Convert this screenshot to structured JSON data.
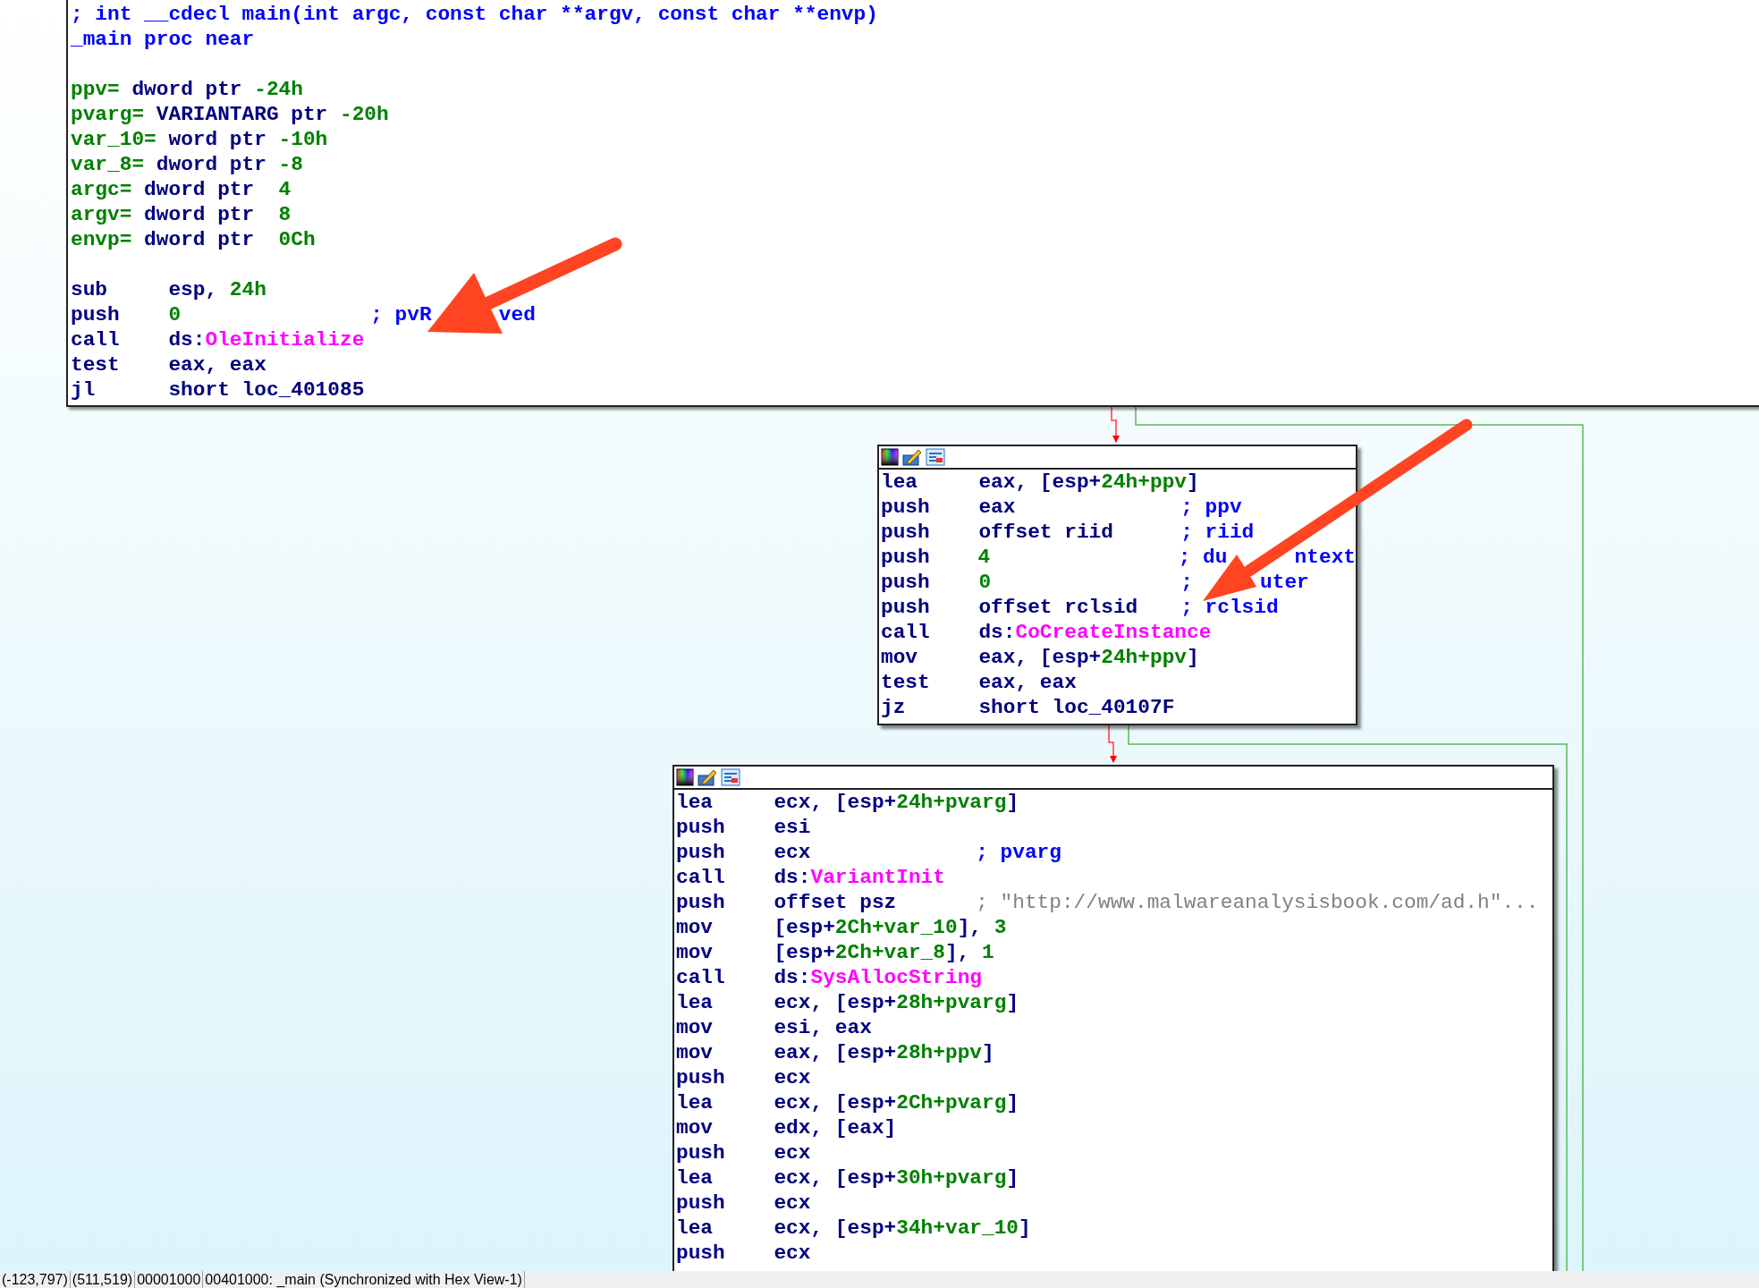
{
  "blocks": [
    {
      "header": [
        [
          {
            "kind": "comment",
            "text": "; int __cdecl main(int argc, const char **argv, const char **envp)"
          }
        ],
        [
          {
            "kind": "comment",
            "text": "_main proc near"
          }
        ]
      ],
      "locals": [
        [
          {
            "kind": "num",
            "text": "ppv="
          },
          {
            "kind": "code",
            "text": " dword ptr "
          },
          {
            "kind": "num",
            "text": "-24h"
          }
        ],
        [
          {
            "kind": "num",
            "text": "pvarg="
          },
          {
            "kind": "code",
            "text": " VARIANTARG ptr "
          },
          {
            "kind": "num",
            "text": "-20h"
          }
        ],
        [
          {
            "kind": "num",
            "text": "var_10="
          },
          {
            "kind": "code",
            "text": " word ptr "
          },
          {
            "kind": "num",
            "text": "-10h"
          }
        ],
        [
          {
            "kind": "num",
            "text": "var_8="
          },
          {
            "kind": "code",
            "text": " dword ptr "
          },
          {
            "kind": "num",
            "text": "-8"
          }
        ],
        [
          {
            "kind": "num",
            "text": "argc="
          },
          {
            "kind": "code",
            "text": " dword ptr  "
          },
          {
            "kind": "num",
            "text": "4"
          }
        ],
        [
          {
            "kind": "num",
            "text": "argv="
          },
          {
            "kind": "code",
            "text": " dword ptr  "
          },
          {
            "kind": "num",
            "text": "8"
          }
        ],
        [
          {
            "kind": "num",
            "text": "envp="
          },
          {
            "kind": "code",
            "text": " dword ptr  "
          },
          {
            "kind": "num",
            "text": "0Ch"
          }
        ]
      ],
      "code": [
        {
          "op": "sub",
          "args": [
            {
              "kind": "code",
              "text": "esp, "
            },
            {
              "kind": "num",
              "text": "24h"
            }
          ]
        },
        {
          "op": "push",
          "args": [
            {
              "kind": "num",
              "text": "0"
            }
          ],
          "comment": {
            "kind": "comment",
            "parts": [
              "; pvR",
              "ved"
            ]
          }
        },
        {
          "op": "call",
          "args": [
            {
              "kind": "code",
              "text": "ds:"
            },
            {
              "kind": "func",
              "text": "OleInitialize"
            }
          ]
        },
        {
          "op": "test",
          "args": [
            {
              "kind": "code",
              "text": "eax, eax"
            }
          ]
        },
        {
          "op": "jl",
          "args": [
            {
              "kind": "code",
              "text": "short loc_401085"
            }
          ]
        }
      ]
    },
    {
      "code": [
        {
          "op": "lea",
          "args": [
            {
              "kind": "code",
              "text": "eax, [esp+"
            },
            {
              "kind": "num",
              "text": "24h+ppv"
            },
            {
              "kind": "code",
              "text": "]"
            }
          ]
        },
        {
          "op": "push",
          "args": [
            {
              "kind": "code",
              "text": "eax"
            }
          ],
          "comment": {
            "kind": "comment",
            "parts": [
              "; ppv"
            ]
          }
        },
        {
          "op": "push",
          "args": [
            {
              "kind": "code",
              "text": "offset riid"
            }
          ],
          "comment": {
            "kind": "comment",
            "parts": [
              "; riid"
            ]
          }
        },
        {
          "op": "push",
          "args": [
            {
              "kind": "num",
              "text": "4"
            }
          ],
          "comment": {
            "kind": "comment",
            "parts": [
              "; du",
              "ntext"
            ]
          }
        },
        {
          "op": "push",
          "args": [
            {
              "kind": "num",
              "text": "0"
            }
          ],
          "comment": {
            "kind": "comment",
            "parts": [
              ";",
              "uter"
            ]
          }
        },
        {
          "op": "push",
          "args": [
            {
              "kind": "code",
              "text": "offset rclsid"
            }
          ],
          "comment": {
            "kind": "comment",
            "parts": [
              "; rclsid"
            ]
          }
        },
        {
          "op": "call",
          "args": [
            {
              "kind": "code",
              "text": "ds:"
            },
            {
              "kind": "func",
              "text": "CoCreateInstance"
            }
          ]
        },
        {
          "op": "mov",
          "args": [
            {
              "kind": "code",
              "text": "eax, [esp+"
            },
            {
              "kind": "num",
              "text": "24h+ppv"
            },
            {
              "kind": "code",
              "text": "]"
            }
          ]
        },
        {
          "op": "test",
          "args": [
            {
              "kind": "code",
              "text": "eax, eax"
            }
          ]
        },
        {
          "op": "jz",
          "args": [
            {
              "kind": "code",
              "text": "short loc_40107F"
            }
          ]
        }
      ]
    },
    {
      "code": [
        {
          "op": "lea",
          "args": [
            {
              "kind": "code",
              "text": "ecx, [esp+"
            },
            {
              "kind": "num",
              "text": "24h+pvarg"
            },
            {
              "kind": "code",
              "text": "]"
            }
          ]
        },
        {
          "op": "push",
          "args": [
            {
              "kind": "code",
              "text": "esi"
            }
          ]
        },
        {
          "op": "push",
          "args": [
            {
              "kind": "code",
              "text": "ecx"
            }
          ],
          "comment": {
            "kind": "comment",
            "parts": [
              "; pvarg"
            ]
          }
        },
        {
          "op": "call",
          "args": [
            {
              "kind": "code",
              "text": "ds:"
            },
            {
              "kind": "func",
              "text": "VariantInit"
            }
          ]
        },
        {
          "op": "push",
          "args": [
            {
              "kind": "code",
              "text": "offset psz"
            }
          ],
          "comment": {
            "kind": "string",
            "parts": [
              "; \"http://www.malwareanalysisbook.com/ad.h\"..."
            ]
          }
        },
        {
          "op": "mov",
          "args": [
            {
              "kind": "code",
              "text": "[esp+"
            },
            {
              "kind": "num",
              "text": "2Ch+var_10"
            },
            {
              "kind": "code",
              "text": "], "
            },
            {
              "kind": "num",
              "text": "3"
            }
          ]
        },
        {
          "op": "mov",
          "args": [
            {
              "kind": "code",
              "text": "[esp+"
            },
            {
              "kind": "num",
              "text": "2Ch+var_8"
            },
            {
              "kind": "code",
              "text": "], "
            },
            {
              "kind": "num",
              "text": "1"
            }
          ]
        },
        {
          "op": "call",
          "args": [
            {
              "kind": "code",
              "text": "ds:"
            },
            {
              "kind": "func",
              "text": "SysAllocString"
            }
          ]
        },
        {
          "op": "lea",
          "args": [
            {
              "kind": "code",
              "text": "ecx, [esp+"
            },
            {
              "kind": "num",
              "text": "28h+pvarg"
            },
            {
              "kind": "code",
              "text": "]"
            }
          ]
        },
        {
          "op": "mov",
          "args": [
            {
              "kind": "code",
              "text": "esi, eax"
            }
          ]
        },
        {
          "op": "mov",
          "args": [
            {
              "kind": "code",
              "text": "eax, [esp+"
            },
            {
              "kind": "num",
              "text": "28h+ppv"
            },
            {
              "kind": "code",
              "text": "]"
            }
          ]
        },
        {
          "op": "push",
          "args": [
            {
              "kind": "code",
              "text": "ecx"
            }
          ]
        },
        {
          "op": "lea",
          "args": [
            {
              "kind": "code",
              "text": "ecx, [esp+"
            },
            {
              "kind": "num",
              "text": "2Ch+pvarg"
            },
            {
              "kind": "code",
              "text": "]"
            }
          ]
        },
        {
          "op": "mov",
          "args": [
            {
              "kind": "code",
              "text": "edx, [eax]"
            }
          ]
        },
        {
          "op": "push",
          "args": [
            {
              "kind": "code",
              "text": "ecx"
            }
          ]
        },
        {
          "op": "lea",
          "args": [
            {
              "kind": "code",
              "text": "ecx, [esp+"
            },
            {
              "kind": "num",
              "text": "30h+pvarg"
            },
            {
              "kind": "code",
              "text": "]"
            }
          ]
        },
        {
          "op": "push",
          "args": [
            {
              "kind": "code",
              "text": "ecx"
            }
          ]
        },
        {
          "op": "lea",
          "args": [
            {
              "kind": "code",
              "text": "ecx, [esp+"
            },
            {
              "kind": "num",
              "text": "34h+var_10"
            },
            {
              "kind": "code",
              "text": "]"
            }
          ]
        },
        {
          "op": "push",
          "args": [
            {
              "kind": "code",
              "text": "ecx"
            }
          ]
        }
      ]
    }
  ],
  "status_bar": [
    "(-123,797)",
    "(511,519)",
    "00001000",
    "00401000: _main (Synchronized with Hex View-1)"
  ]
}
